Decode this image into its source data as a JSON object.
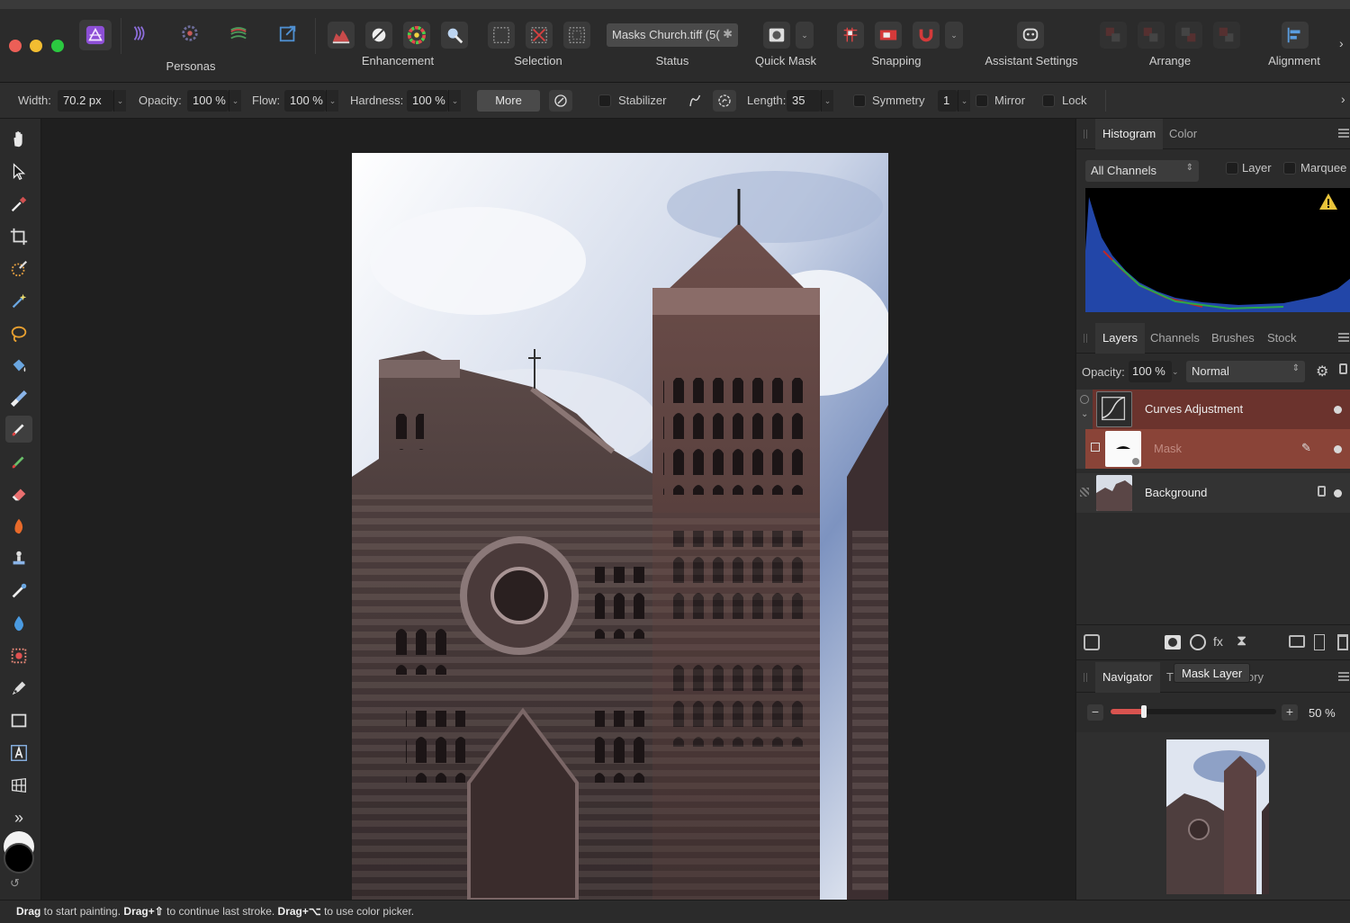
{
  "toolbar": {
    "personas_label": "Personas",
    "enhancement_label": "Enhancement",
    "selection_label": "Selection",
    "status_label": "Status",
    "status_doc": "Masks Church.tiff (5(",
    "quick_mask_label": "Quick Mask",
    "snapping_label": "Snapping",
    "assistant_label": "Assistant Settings",
    "arrange_label": "Arrange",
    "alignment_label": "Alignment"
  },
  "context": {
    "width_label": "Width:",
    "width_value": "70.2 px",
    "opacity_label": "Opacity:",
    "opacity_value": "100 %",
    "flow_label": "Flow:",
    "flow_value": "100 %",
    "hardness_label": "Hardness:",
    "hardness_value": "100 %",
    "more_label": "More",
    "stabilizer_label": "Stabilizer",
    "length_label": "Length:",
    "length_value": "35",
    "symmetry_label": "Symmetry",
    "symmetry_value": "1",
    "mirror_label": "Mirror",
    "lock_label": "Lock"
  },
  "histogram": {
    "tabs": [
      "Histogram",
      "Color"
    ],
    "channel": "All Channels",
    "layer_label": "Layer",
    "marquee_label": "Marquee"
  },
  "layers": {
    "tabs": [
      "Layers",
      "Channels",
      "Brushes",
      "Stock"
    ],
    "opacity_label": "Opacity:",
    "opacity_value": "100 %",
    "blend_mode": "Normal",
    "items": [
      {
        "name": "Curves Adjustment"
      },
      {
        "name": "Mask"
      },
      {
        "name": "Background"
      }
    ]
  },
  "navigator": {
    "tabs": [
      "Navigator",
      "Tr",
      "ory"
    ],
    "zoom_value": "50 %",
    "zoom_level": 0.2
  },
  "tooltip": "Mask Layer",
  "status": {
    "part1_bold": "Drag",
    "part1": " to start painting. ",
    "part2_bold": "Drag+⇧",
    "part2": " to continue last stroke. ",
    "part3_bold": "Drag+⌥",
    "part3": " to use color picker."
  },
  "colors": {
    "accent_red": "#d9534f",
    "selected_layer": "#7a3a33",
    "mask_row": "#8a4438",
    "persona_purple": "#7b3fc4"
  }
}
